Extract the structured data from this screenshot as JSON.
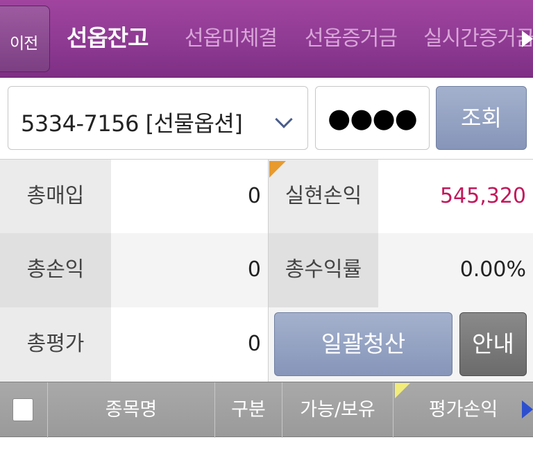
{
  "header": {
    "back_label": "이전",
    "tabs": [
      {
        "label": "선옵잔고",
        "active": true
      },
      {
        "label": "선옵미체결",
        "active": false
      },
      {
        "label": "선옵증거금",
        "active": false
      },
      {
        "label": "실시간증거금",
        "active": false
      }
    ],
    "colors": {
      "header_bg": "#8e3a93",
      "active_tab": "#ffffff",
      "inactive_tab": "#d9a6d8"
    }
  },
  "account": {
    "selected": "5334-7156 [선물옵션]",
    "password_masked": "●●●●",
    "query_label": "조회"
  },
  "summary": {
    "total_buy_label": "총매입",
    "total_buy_value": "0",
    "realized_pl_label": "실현손익",
    "realized_pl_value": "545,320",
    "total_pl_label": "총손익",
    "total_pl_value": "0",
    "total_return_label": "총수익률",
    "total_return_value": "0.00%",
    "total_eval_label": "총평가",
    "total_eval_value": "0",
    "liquidate_label": "일괄청산",
    "guide_label": "안내",
    "colors": {
      "positive_value": "#c2185b",
      "button_blue": "#8d9bbf",
      "button_gray": "#767676"
    }
  },
  "table": {
    "columns": [
      "종목명",
      "구분",
      "가능/보유",
      "평가손익"
    ]
  }
}
